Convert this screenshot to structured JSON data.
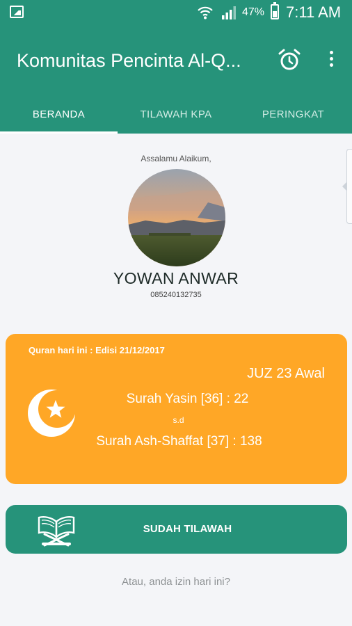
{
  "status_bar": {
    "battery": "47%",
    "time": "7:11 AM",
    "icons": [
      "gallery-icon",
      "wifi-icon",
      "signal-icon",
      "battery-icon"
    ]
  },
  "app_bar": {
    "title": "Komunitas Pencinta Al-Q...",
    "actions": [
      "alarm-icon",
      "more-vert-icon"
    ]
  },
  "tabs": [
    {
      "label": "BERANDA",
      "active": true
    },
    {
      "label": "TILAWAH KPA",
      "active": false
    },
    {
      "label": "PERINGKAT",
      "active": false
    }
  ],
  "profile": {
    "greeting": "Assalamu Alaikum,",
    "name": "YOWAN ANWAR",
    "phone": "085240132735"
  },
  "quran_today": {
    "edition": "Quran hari ini : Edisi 21/12/2017",
    "juz": "JUZ 23 Awal",
    "from": "Surah Yasin [36] : 22",
    "separator": "s.d",
    "to": "Surah Ash-Shaffat [37] : 138",
    "icon": "crescent-star-icon"
  },
  "actions": {
    "tilawah_button": "SUDAH TILAWAH",
    "tilawah_icon": "quran-book-icon",
    "izin_link": "Atau, anda izin hari ini?"
  },
  "colors": {
    "primary": "#26937a",
    "card_orange": "#ffa726",
    "background": "#f4f5f8"
  }
}
